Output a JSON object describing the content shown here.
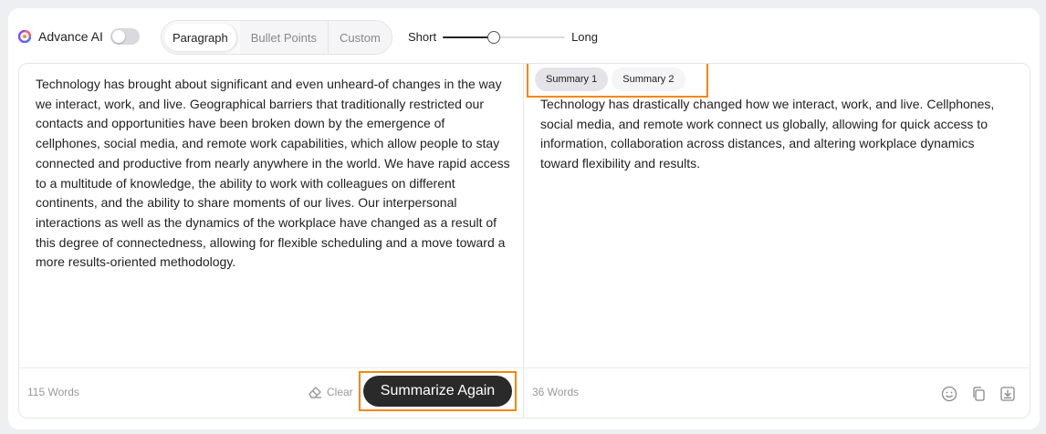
{
  "toolbar": {
    "advance_label": "Advance AI",
    "advance_enabled": false,
    "modes": [
      {
        "label": "Paragraph",
        "active": true
      },
      {
        "label": "Bullet Points",
        "active": false
      },
      {
        "label": "Custom",
        "active": false
      }
    ],
    "length": {
      "min_label": "Short",
      "max_label": "Long",
      "value": 0.42
    }
  },
  "input_panel": {
    "text": "Technology has brought about significant and even unheard-of changes in the way we interact, work, and live. Geographical barriers that traditionally restricted our contacts and opportunities have been broken down by the emergence of cellphones, social media, and remote work capabilities, which allow people to stay connected and productive from nearly anywhere in the world. We have rapid access to a multitude of knowledge, the ability to work with colleagues on different continents, and the ability to share moments of our lives. Our interpersonal interactions as well as the dynamics of the workplace have changed as a result of this degree of connectedness, allowing for flexible scheduling and a move toward a more results-oriented methodology.",
    "word_count": "115 Words",
    "clear_label": "Clear",
    "submit_label": "Summarize Again"
  },
  "output_panel": {
    "tabs": [
      {
        "label": "Summary 1",
        "active": true
      },
      {
        "label": "Summary 2",
        "active": false
      }
    ],
    "text": "Technology has drastically changed how we interact, work, and live. Cellphones, social media, and remote work connect us globally, allowing for quick access to information, collaboration across distances, and altering workplace dynamics toward flexibility and results.",
    "word_count": "36 Words",
    "icons": [
      "smile-icon",
      "copy-icon",
      "download-icon"
    ]
  },
  "colors": {
    "highlight": "#f5860c",
    "primary_button": "#2a2a2a",
    "background": "#eeeff2"
  }
}
